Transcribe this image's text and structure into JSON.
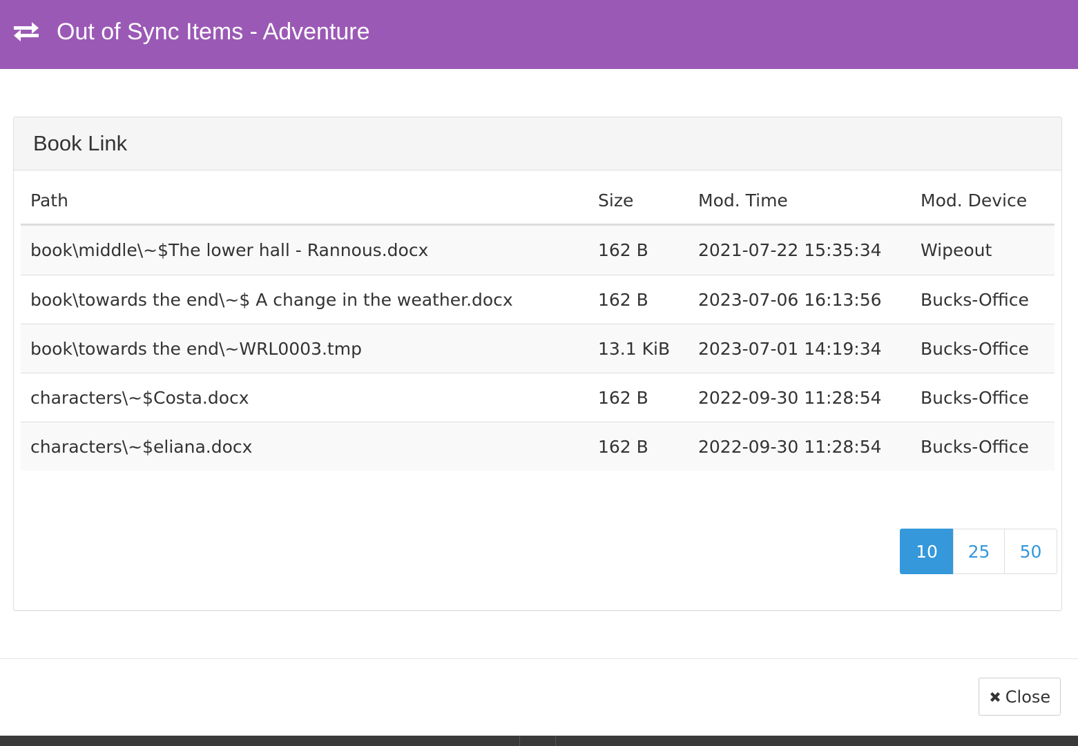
{
  "header": {
    "icon": "exchange-arrows-icon",
    "title": "Out of Sync Items - Adventure",
    "color": "#9b59b6"
  },
  "panel": {
    "title": "Book Link"
  },
  "table": {
    "columns": [
      "Path",
      "Size",
      "Mod. Time",
      "Mod. Device"
    ],
    "rows": [
      {
        "path": "book\\middle\\~$The lower hall - Rannous.docx",
        "size": "162 B",
        "mod_time": "2021-07-22 15:35:34",
        "mod_device": "Wipeout"
      },
      {
        "path": "book\\towards the end\\~$ A change in the weather.docx",
        "size": "162 B",
        "mod_time": "2023-07-06 16:13:56",
        "mod_device": "Bucks-Office"
      },
      {
        "path": "book\\towards the end\\~WRL0003.tmp",
        "size": "13.1 KiB",
        "mod_time": "2023-07-01 14:19:34",
        "mod_device": "Bucks-Office"
      },
      {
        "path": "characters\\~$Costa.docx",
        "size": "162 B",
        "mod_time": "2022-09-30 11:28:54",
        "mod_device": "Bucks-Office"
      },
      {
        "path": "characters\\~$eliana.docx",
        "size": "162 B",
        "mod_time": "2022-09-30 11:28:54",
        "mod_device": "Bucks-Office"
      }
    ]
  },
  "page_size": {
    "options": [
      "10",
      "25",
      "50"
    ],
    "selected": "10",
    "active_color": "#3498db"
  },
  "footer": {
    "close_icon": "close-x-icon",
    "close_label": "Close"
  }
}
